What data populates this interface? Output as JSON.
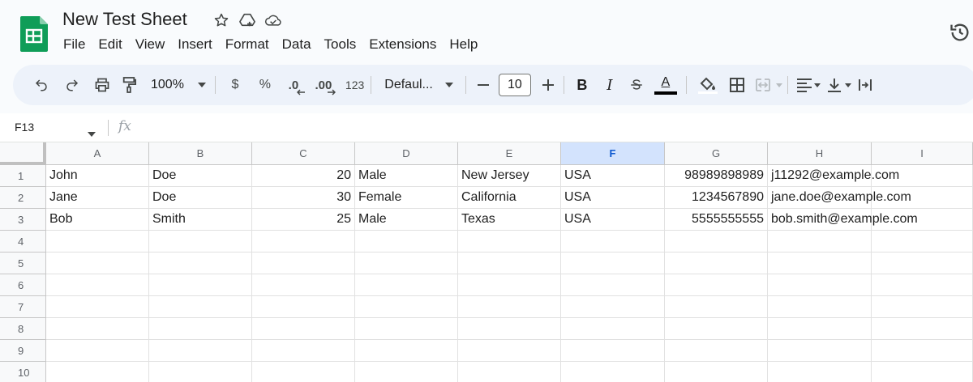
{
  "doc": {
    "title": "New Test Sheet"
  },
  "menu": [
    "File",
    "Edit",
    "View",
    "Insert",
    "Format",
    "Data",
    "Tools",
    "Extensions",
    "Help"
  ],
  "toolbar": {
    "zoom": "100%",
    "currency": "$",
    "percent": "%",
    "decrease_decimal": ".0",
    "increase_decimal": ".00",
    "number_format": "123",
    "font": "Defaul...",
    "font_size": "10",
    "bold": "B",
    "italic": "I",
    "text_color_letter": "A"
  },
  "formula_bar": {
    "cell_ref": "F13",
    "fx": "fx"
  },
  "sheet": {
    "columns": [
      "A",
      "B",
      "C",
      "D",
      "E",
      "F",
      "G",
      "H",
      "I"
    ],
    "selected_column": "F",
    "row_numbers": [
      "1",
      "2",
      "3",
      "4",
      "5",
      "6",
      "7",
      "8",
      "9",
      "10"
    ],
    "rows": [
      [
        "John",
        "Doe",
        "20",
        "Male",
        "New Jersey",
        "USA",
        "98989898989",
        "j11292@example.com",
        ""
      ],
      [
        "Jane",
        "Doe",
        "30",
        "Female",
        "California",
        "USA",
        "1234567890",
        "jane.doe@example.com",
        ""
      ],
      [
        "Bob",
        "Smith",
        "25",
        "Male",
        "Texas",
        "USA",
        "5555555555",
        "bob.smith@example.com",
        ""
      ]
    ]
  },
  "colors": {
    "accent": "#0b57d0",
    "toolbar_bg": "#edf2fa",
    "selected_header": "#d3e3fd",
    "logo_green": "#0f9d58"
  }
}
